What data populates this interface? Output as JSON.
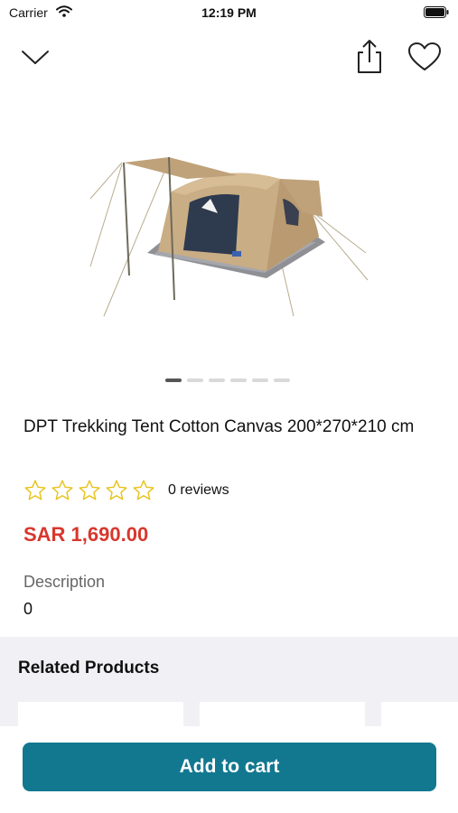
{
  "status_bar": {
    "carrier": "Carrier",
    "time": "12:19 PM"
  },
  "nav": {
    "back_icon": "chevron-down-icon",
    "share_icon": "share-icon",
    "favorite_icon": "heart-icon"
  },
  "gallery": {
    "page_count": 6,
    "active_index": 0
  },
  "product": {
    "title": "DPT Trekking Tent Cotton Canvas 200*270*210 cm",
    "rating": 0,
    "max_rating": 5,
    "reviews_text": "0 reviews",
    "price": "SAR 1,690.00",
    "description_label": "Description",
    "description_value": "0"
  },
  "related": {
    "title": "Related Products"
  },
  "actions": {
    "add_to_cart": "Add to cart"
  },
  "colors": {
    "accent": "#127890",
    "price": "#d8372d",
    "star": "#e8c21a",
    "related_bg": "#f1f1f5"
  }
}
